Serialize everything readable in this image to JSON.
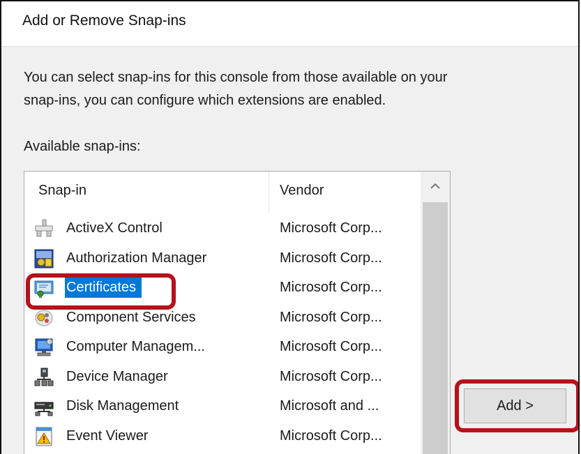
{
  "window": {
    "title": "Add or Remove Snap-ins"
  },
  "intro": {
    "line1": "You can select snap-ins for this console from those available on your",
    "line2": "snap-ins, you can configure which extensions are enabled."
  },
  "available": {
    "label": "Available snap-ins:",
    "columns": {
      "snapin": "Snap-in",
      "vendor": "Vendor"
    },
    "selected": "Certificates",
    "items": [
      {
        "name": "ActiveX Control",
        "vendor": "Microsoft Corp...",
        "icon": "activex-control-icon"
      },
      {
        "name": "Authorization Manager",
        "vendor": "Microsoft Corp...",
        "icon": "authorization-manager-icon"
      },
      {
        "name": "Certificates",
        "vendor": "Microsoft Corp...",
        "icon": "certificates-icon"
      },
      {
        "name": "Component Services",
        "vendor": "Microsoft Corp...",
        "icon": "component-services-icon"
      },
      {
        "name": "Computer Managem...",
        "vendor": "Microsoft Corp...",
        "icon": "computer-management-icon"
      },
      {
        "name": "Device Manager",
        "vendor": "Microsoft Corp...",
        "icon": "device-manager-icon"
      },
      {
        "name": "Disk Management",
        "vendor": "Microsoft and ...",
        "icon": "disk-management-icon"
      },
      {
        "name": "Event Viewer",
        "vendor": "Microsoft Corp...",
        "icon": "event-viewer-icon"
      }
    ]
  },
  "buttons": {
    "add": "Add >"
  },
  "colors": {
    "selection": "#0078d7",
    "highlight": "#b5121b",
    "dialog_bg": "#f0f0f0"
  }
}
